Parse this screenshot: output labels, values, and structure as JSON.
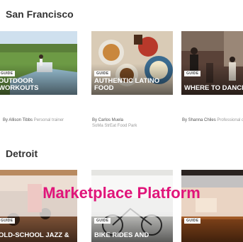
{
  "sections": [
    {
      "title": "San Francisco",
      "cards": [
        {
          "badge": "GUIDE",
          "title": "OUTDOOR WORKOUTS",
          "author": "By Allison Tibbs",
          "role": "Personal trainer"
        },
        {
          "badge": "GUIDE",
          "title": "AUTHENTIC LATINO FOOD",
          "author": "By Carlos Muela",
          "role": "SoMa StrEat Food Park"
        },
        {
          "badge": "GUIDE",
          "title": "WHERE TO DANCE",
          "author": "By Shanna Chiles",
          "role": "Professional dancer"
        }
      ]
    },
    {
      "title": "Detroit",
      "cards": [
        {
          "badge": "GUIDE",
          "title": "OLD-SCHOOL JAZZ &"
        },
        {
          "badge": "GUIDE",
          "title": "BIKE RIDES AND"
        },
        {
          "badge": "GUIDE",
          "title": ""
        }
      ]
    }
  ],
  "overlay_label": "Marketplace Platform",
  "colors": {
    "overlay_text": "#e0157a",
    "section_title": "#333333"
  }
}
